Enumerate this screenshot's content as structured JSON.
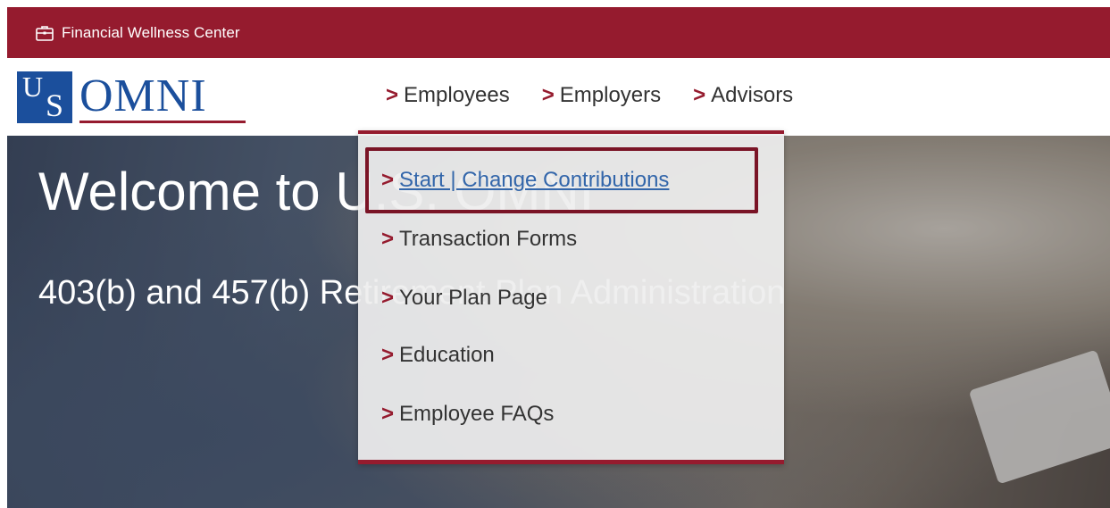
{
  "topbar": {
    "label": "Financial Wellness Center",
    "icon": "briefcase-icon"
  },
  "logo": {
    "us_u": "U",
    "us_s": "S",
    "omni": "OMNI"
  },
  "nav": {
    "chevron": ">",
    "items": [
      {
        "label": "Employees"
      },
      {
        "label": "Employers"
      },
      {
        "label": "Advisors"
      }
    ]
  },
  "hero": {
    "title": "Welcome to U.S. OMNI",
    "subtitle": "403(b) and 457(b) Retirement Plan Administration"
  },
  "dropdown": {
    "items": [
      {
        "label": "Start | Change Contributions"
      },
      {
        "label": "Transaction Forms"
      },
      {
        "label": "Your Plan Page"
      },
      {
        "label": "Education"
      },
      {
        "label": "Employee FAQs"
      }
    ]
  },
  "colors": {
    "brand_red": "#951b2e",
    "brand_blue": "#1b4f9c",
    "link_blue": "#3366aa"
  }
}
